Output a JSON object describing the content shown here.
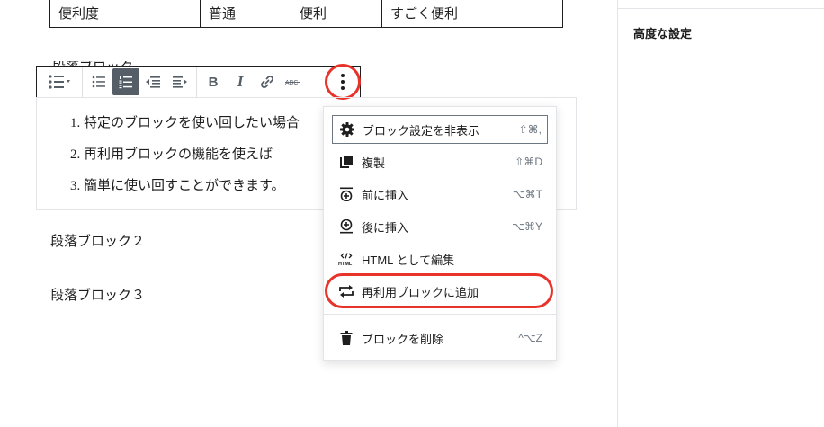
{
  "table": {
    "cells": [
      "便利度",
      "普通",
      "便利",
      "すごく便利"
    ]
  },
  "hidden_heading": "段落ブロック",
  "toolbar": {
    "list_style_label": "リスト",
    "bold_label": "B",
    "italic_label": "I"
  },
  "list": {
    "items": [
      "1. 特定のブロックを使い回したい場合",
      "2. 再利用ブロックの機能を使えば",
      "3. 簡単に使い回すことができます。"
    ]
  },
  "paragraphs": [
    "段落ブロック２",
    "段落ブロック３"
  ],
  "menu": {
    "items": [
      {
        "label": "ブロック設定を非表示",
        "shortcut": "⇧⌘,",
        "icon": "gear-icon"
      },
      {
        "label": "複製",
        "shortcut": "⇧⌘D",
        "icon": "copy-icon"
      },
      {
        "label": "前に挿入",
        "shortcut": "⌥⌘T",
        "icon": "insert-before-icon"
      },
      {
        "label": "後に挿入",
        "shortcut": "⌥⌘Y",
        "icon": "insert-after-icon"
      },
      {
        "label": "HTML として編集",
        "shortcut": "",
        "icon": "html-icon"
      },
      {
        "label": "再利用ブロックに追加",
        "shortcut": "",
        "icon": "reusable-icon"
      },
      {
        "label": "ブロックを削除",
        "shortcut": "^⌥Z",
        "icon": "trash-icon"
      }
    ]
  },
  "sidebar": {
    "title": "高度な設定"
  },
  "colors": {
    "highlight": "#e8332b",
    "active_button": "#555d66",
    "border": "#e2e4e7"
  }
}
